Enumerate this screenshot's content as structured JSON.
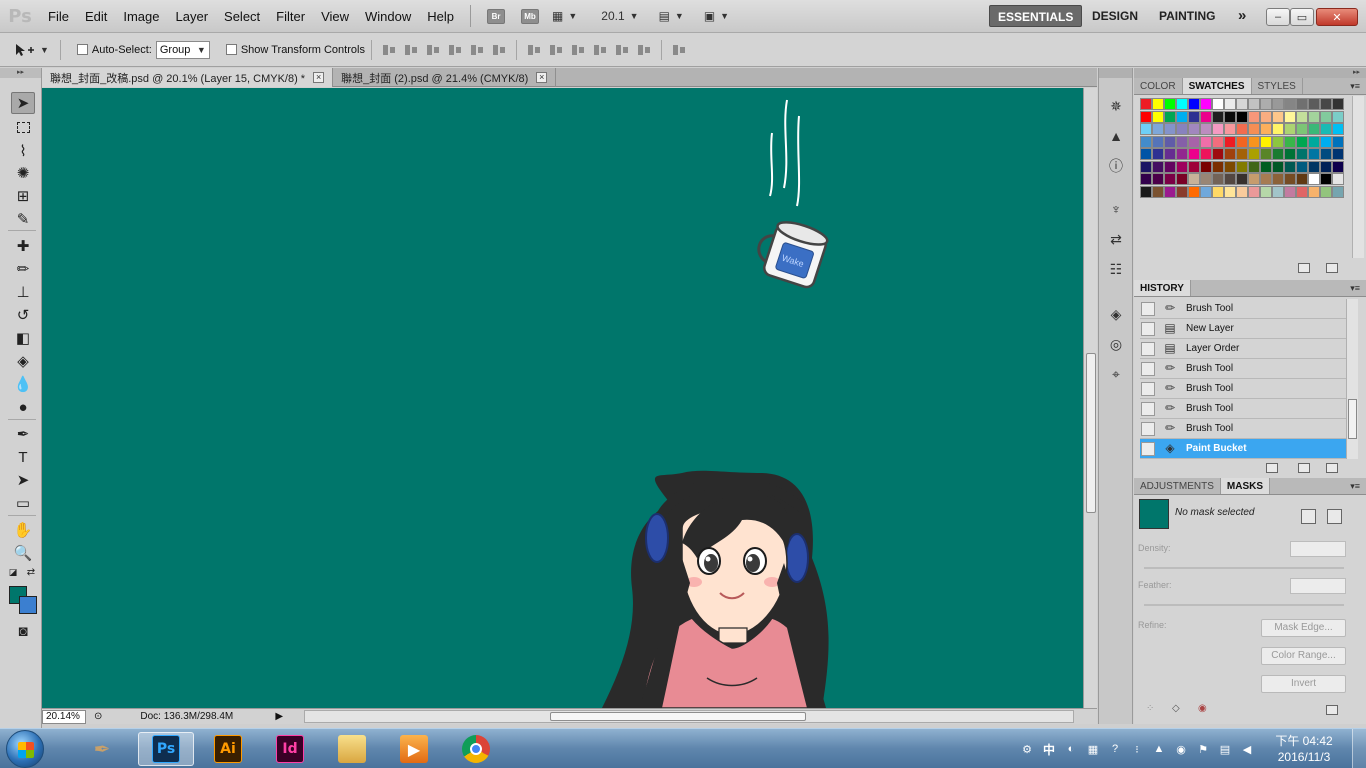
{
  "app": {
    "logo_text": "Ps",
    "menu": [
      "File",
      "Edit",
      "Image",
      "Layer",
      "Select",
      "Filter",
      "View",
      "Window",
      "Help"
    ],
    "bridge_label": "Br",
    "minibridge_label": "Mb",
    "zoom_menu_value": "20.1",
    "workspaces": {
      "essentials": "ESSENTIALS",
      "design": "DESIGN",
      "painting": "PAINTING",
      "more": "»"
    },
    "window_controls": {
      "minimize": "–",
      "maximize": "▭",
      "close": "✕"
    }
  },
  "options_bar": {
    "auto_select_label": "Auto-Select:",
    "auto_select_value": "Group",
    "auto_select_checked": false,
    "show_transform_label": "Show Transform Controls",
    "show_transform_checked": false
  },
  "document_tabs": [
    {
      "label": "聯想_封面_改稿.psd @ 20.1% (Layer 15, CMYK/8) *",
      "active": true
    },
    {
      "label": "聯想_封面 (2).psd @ 21.4% (CMYK/8)",
      "active": false
    }
  ],
  "colors": {
    "foreground": "#00766b",
    "background": "#3b7fd0",
    "canvas": "#00766b",
    "selection": "#3ba6f0"
  },
  "status": {
    "zoom": "20.14%",
    "doc_info": "Doc: 136.3M/298.4M"
  },
  "panels": {
    "color_group": {
      "tabs": [
        "COLOR",
        "SWATCHES",
        "STYLES"
      ],
      "active_tab": "SWATCHES",
      "swatches": [
        "#ed1c24",
        "#ffff00",
        "#00ff00",
        "#00ffff",
        "#0000ff",
        "#ff00ff",
        "#ffffff",
        "#ebebeb",
        "#d6d6d6",
        "#c2c2c2",
        "#adadad",
        "#999999",
        "#858585",
        "#707070",
        "#5c5c5c",
        "#474747",
        "#333333",
        "#ff0000",
        "#ffff00",
        "#00a651",
        "#00aeef",
        "#2e3192",
        "#ec008c",
        "#1f1f1f",
        "#0a0a0a",
        "#000000",
        "#f7977a",
        "#f9ad81",
        "#fdc68a",
        "#fff79a",
        "#c4df9b",
        "#a3d39c",
        "#82ca9d",
        "#7bcdc8",
        "#6ecff6",
        "#7ea7d8",
        "#8493ca",
        "#8882be",
        "#a187be",
        "#bc8dbf",
        "#f49ac2",
        "#f6989d",
        "#f26c4f",
        "#f68e55",
        "#fbaf5c",
        "#fff467",
        "#acd372",
        "#7cc576",
        "#3bb878",
        "#1abbb4",
        "#00bff3",
        "#438ccb",
        "#5574b9",
        "#605ca8",
        "#855fa8",
        "#a763a8",
        "#f06ea9",
        "#f26d7d",
        "#ed1c24",
        "#f26522",
        "#f7941d",
        "#fff200",
        "#8dc63f",
        "#39b54a",
        "#00a651",
        "#00a99d",
        "#00aeef",
        "#0072bc",
        "#0054a6",
        "#2e3192",
        "#662d91",
        "#92278f",
        "#ec008c",
        "#ed145b",
        "#9e0b0f",
        "#a0410d",
        "#a36209",
        "#aba000",
        "#598527",
        "#1a7b30",
        "#007236",
        "#00746b",
        "#0076a3",
        "#004b80",
        "#003471",
        "#1b1464",
        "#440e62",
        "#630460",
        "#9e005d",
        "#9e0039",
        "#790000",
        "#7b2e00",
        "#7d4900",
        "#827b00",
        "#406618",
        "#005e20",
        "#005826",
        "#005952",
        "#005b7f",
        "#003663",
        "#002157",
        "#0d004c",
        "#32004b",
        "#4b0049",
        "#7b0046",
        "#7a0026",
        "#c7b299",
        "#998675",
        "#736357",
        "#534741",
        "#37302d",
        "#c69c6d",
        "#a67c52",
        "#8c6239",
        "#754c24",
        "#603913",
        "#ffffff",
        "#000000",
        "#e5e5e5",
        "#1a1a1a",
        "#7a5230",
        "#9b1b8f",
        "#8a3c2c",
        "#ff6a00",
        "#6fa8dc",
        "#ffd966",
        "#ffe599",
        "#f9cb9c",
        "#ea9999",
        "#b6d7a8",
        "#a2c4c9",
        "#c27ba0",
        "#e06666",
        "#f6b26b",
        "#93c47d",
        "#76a5af"
      ]
    },
    "history": {
      "tab": "HISTORY",
      "items": [
        {
          "label": "Brush Tool",
          "icon": "brush-icon",
          "selected": false
        },
        {
          "label": "New Layer",
          "icon": "layer-doc-icon",
          "selected": false
        },
        {
          "label": "Layer Order",
          "icon": "layer-doc-icon",
          "selected": false
        },
        {
          "label": "Brush Tool",
          "icon": "brush-icon",
          "selected": false
        },
        {
          "label": "Brush Tool",
          "icon": "brush-icon",
          "selected": false
        },
        {
          "label": "Brush Tool",
          "icon": "brush-icon",
          "selected": false
        },
        {
          "label": "Brush Tool",
          "icon": "brush-icon",
          "selected": false
        },
        {
          "label": "Paint Bucket",
          "icon": "paint-bucket-icon",
          "selected": true
        }
      ]
    },
    "masks": {
      "tabs": [
        "ADJUSTMENTS",
        "MASKS"
      ],
      "active_tab": "MASKS",
      "status": "No mask selected",
      "density_label": "Density:",
      "feather_label": "Feather:",
      "refine_label": "Refine:",
      "mask_edge_button": "Mask Edge...",
      "color_range_button": "Color Range...",
      "invert_button": "Invert"
    }
  },
  "taskbar": {
    "apps": [
      {
        "name": "pen-app",
        "label": "",
        "active": false
      },
      {
        "name": "photoshop",
        "label": "Ps",
        "active": true
      },
      {
        "name": "illustrator",
        "label": "Ai",
        "active": false
      },
      {
        "name": "indesign",
        "label": "Id",
        "active": false
      },
      {
        "name": "explorer",
        "label": "",
        "active": false
      },
      {
        "name": "media-player",
        "label": "",
        "active": false
      },
      {
        "name": "chrome",
        "label": "",
        "active": false
      }
    ],
    "ime": "中",
    "clock_time": "下午 04:42",
    "clock_date": "2016/11/3"
  }
}
